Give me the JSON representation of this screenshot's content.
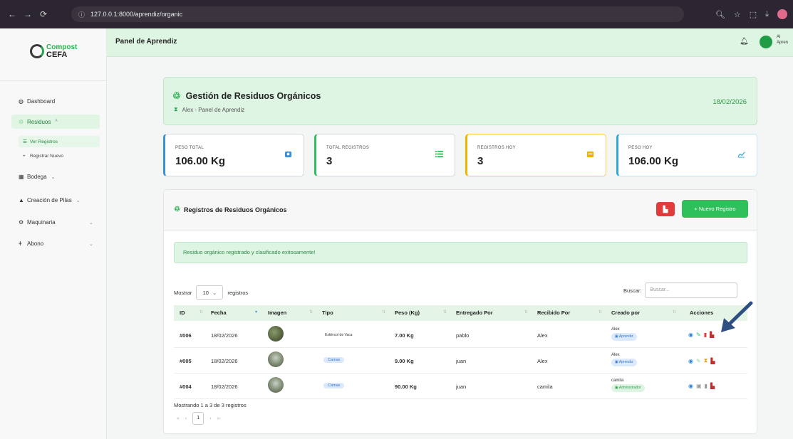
{
  "browser": {
    "url": "127.0.0.1:8000/aprendiz/organic"
  },
  "brand": {
    "line1": "Compost",
    "line2": "CEFA"
  },
  "sidebar": {
    "items": [
      {
        "label": "Dashboard"
      },
      {
        "label": "Residuos"
      },
      {
        "label": "Ver Registros"
      },
      {
        "label": "Registrar Nuevo"
      },
      {
        "label": "Bodega"
      },
      {
        "label": "Creación de Pilas"
      },
      {
        "label": "Maquinaria"
      },
      {
        "label": "Abono"
      }
    ]
  },
  "topbar": {
    "title": "Panel de Aprendiz",
    "user_name": "Al",
    "user_role": "Apren"
  },
  "header": {
    "title": "Gestión de Residuos Orgánicos",
    "subtitle": "Alex - Panel de Aprendiz",
    "date": "18/02/2026"
  },
  "stats": [
    {
      "label": "PESO TOTAL",
      "value": "106.00 Kg",
      "icon": "scale-icon",
      "color": "#3b8fd9"
    },
    {
      "label": "TOTAL REGISTROS",
      "value": "3",
      "icon": "list-icon",
      "color": "#2fbf5b"
    },
    {
      "label": "REGISTROS HOY",
      "value": "3",
      "icon": "calendar-icon",
      "color": "#f0b400"
    },
    {
      "label": "PESO HOY",
      "value": "106.00 Kg",
      "icon": "chart-line-icon",
      "color": "#2fa8d9"
    }
  ],
  "panel": {
    "title": "Registros de Residuos Orgánicos",
    "new_button": "+ Nuevo Registro",
    "alert": "Residuo orgánico registrado y clasificado exitosamente!",
    "show_label": "Mostrar",
    "page_length": "10",
    "records_label": "registros",
    "search_label": "Buscar:",
    "search_placeholder": "Buscar...",
    "footer_info": "Mostrando 1 a 3 de 3 registros",
    "current_page": "1"
  },
  "table": {
    "headers": [
      "ID",
      "Fecha",
      "Imagen",
      "Tipo",
      "Peso (Kg)",
      "Entregado Por",
      "Recibido Por",
      "Creado por",
      "Acciones"
    ],
    "rows": [
      {
        "id": "#006",
        "fecha": "18/02/2026",
        "tipo": "Estiércol de Vaca",
        "peso": "7.00 Kg",
        "entregado": "pablo",
        "recibido": "Alex",
        "creado": "Alex",
        "rol": "Aprendiz"
      },
      {
        "id": "#005",
        "fecha": "18/02/2026",
        "tipo": "Camas",
        "peso": "9.00 Kg",
        "entregado": "juan",
        "recibido": "Alex",
        "creado": "Alex",
        "rol": "Aprendiz"
      },
      {
        "id": "#004",
        "fecha": "18/02/2026",
        "tipo": "Camas",
        "peso": "90.00 Kg",
        "entregado": "juan",
        "recibido": "camila",
        "creado": "camila",
        "rol": "Administrador"
      }
    ]
  }
}
